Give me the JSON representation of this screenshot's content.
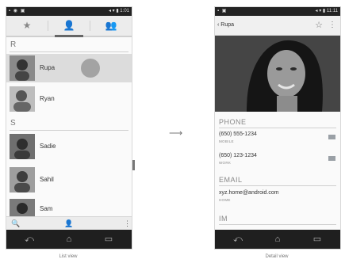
{
  "list_view": {
    "caption": "List view",
    "tabs": [
      {
        "icon": "star-icon",
        "glyph": "★"
      },
      {
        "icon": "person-icon",
        "glyph": "👤"
      },
      {
        "icon": "group-icon",
        "glyph": "👥"
      }
    ],
    "sections": [
      "R",
      "S"
    ],
    "contacts": [
      {
        "name": "Rupa",
        "selected": true
      },
      {
        "name": "Ryan"
      },
      {
        "name": "Sadie"
      },
      {
        "name": "Sahil"
      },
      {
        "name": "Sam"
      }
    ],
    "actions": {
      "search_glyph": "🔍",
      "add_contact_glyph": "👤",
      "menu_glyph": "⋮"
    }
  },
  "detail_view": {
    "caption": "Detail view",
    "title": "Rupa",
    "back_glyph": "‹",
    "star_glyph": "☆",
    "menu_glyph": "⋮",
    "sections": {
      "phone": "PHONE",
      "email": "EMAIL",
      "im": "IM"
    },
    "phones": [
      {
        "number": "(650) 555-1234",
        "type": "MOBILE"
      },
      {
        "number": "(650) 123-1234",
        "type": "WORK"
      }
    ],
    "email": {
      "address": "xyz.home@android.com",
      "type": "HOME"
    }
  },
  "nav": {
    "back": "⤺",
    "home": "⌂",
    "recents": "▭"
  },
  "transition_arrow": "⟶",
  "colors": {
    "navbar": "#1f1f1f",
    "selected_row": "#dcdcdc",
    "tab_bar": "#ececec"
  }
}
